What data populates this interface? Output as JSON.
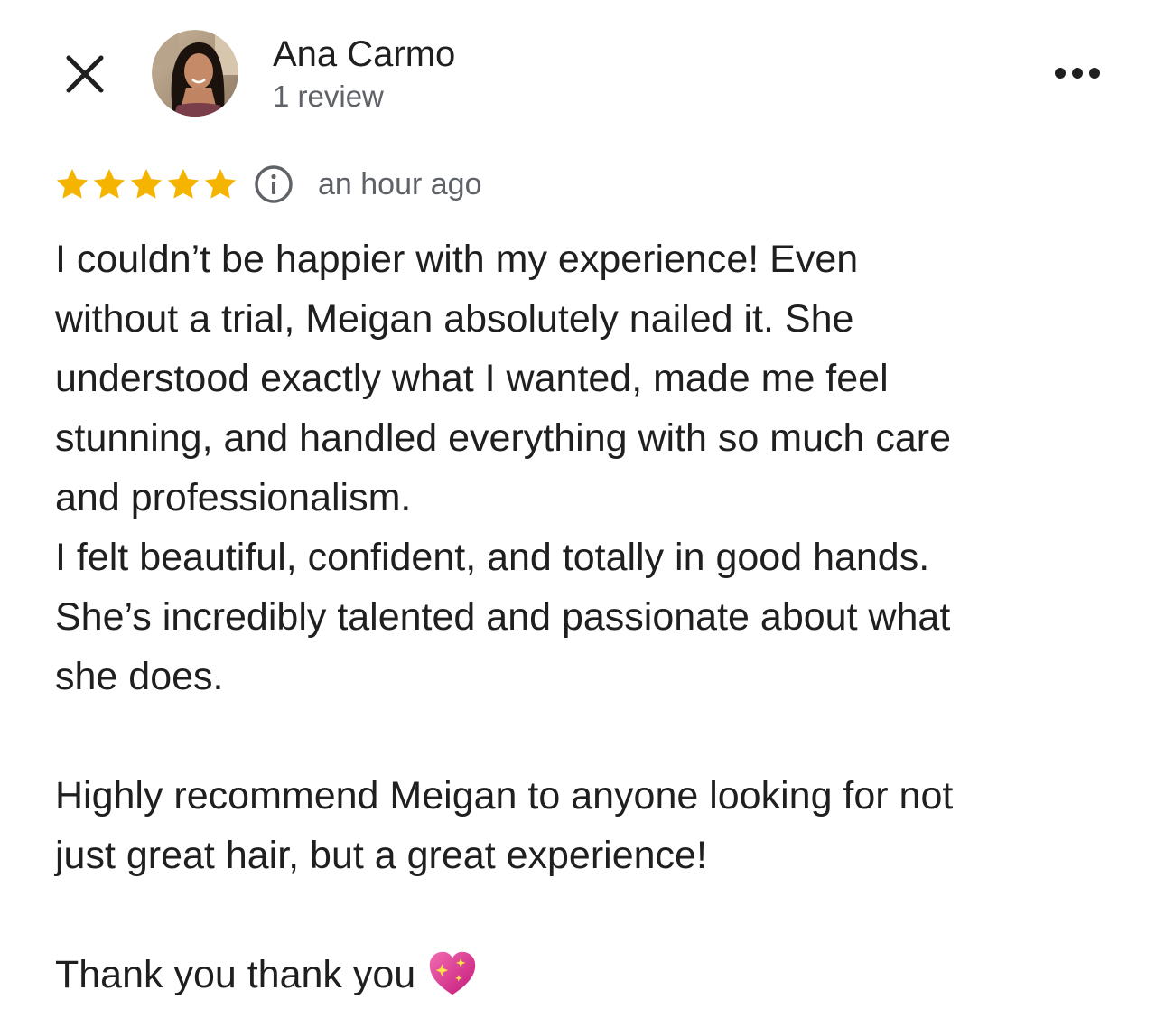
{
  "reviewer": {
    "name": "Ana Carmo",
    "review_count": "1 review"
  },
  "icons": {
    "close": "close-icon",
    "avatar": "avatar-photo",
    "more": "more-options-icon",
    "info": "info-icon",
    "star": "star-icon",
    "heart": "sparkling-heart-icon"
  },
  "rating": {
    "stars": 5,
    "max_stars": 5,
    "timestamp": "an hour ago"
  },
  "review": {
    "lines": [
      "I couldn’t be happier with my experience! Even",
      "without a trial, Meigan absolutely nailed it. She",
      "understood exactly what I wanted, made me feel",
      "stunning, and handled everything with so much care",
      "and professionalism.",
      "I felt beautiful, confident, and totally in good hands.",
      "She’s incredibly talented and passionate about what",
      "she does.",
      "",
      "Highly recommend Meigan to anyone looking for not",
      "just great hair, but a great experience!",
      "",
      "Thank you thank you"
    ]
  },
  "colors": {
    "star": "#f4b400",
    "text_primary": "#1f1f1f",
    "text_secondary": "#5f6368",
    "heart": "#e9398f"
  }
}
